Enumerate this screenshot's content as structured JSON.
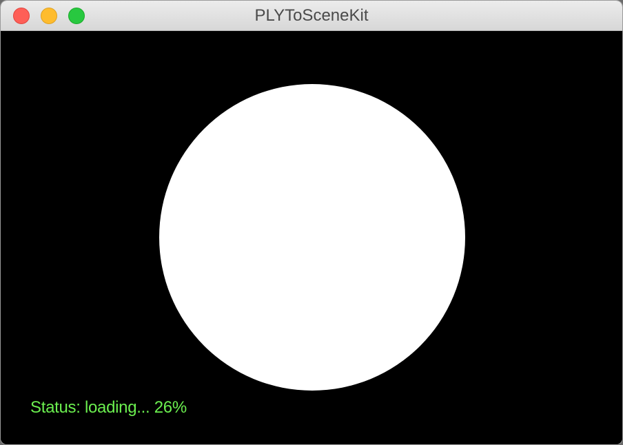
{
  "window": {
    "title": "PLYToSceneKit"
  },
  "titlebar": {
    "buttons": [
      "close",
      "minimize",
      "zoom"
    ]
  },
  "scene": {
    "status_text": "Status: loading... 26%",
    "progress_percent": 26,
    "background_color": "#000000",
    "object_color": "#ffffff",
    "status_color": "#6bef4f"
  },
  "colors": {
    "close": "#fe5f57",
    "minimize": "#febc2e",
    "zoom": "#28c840"
  }
}
